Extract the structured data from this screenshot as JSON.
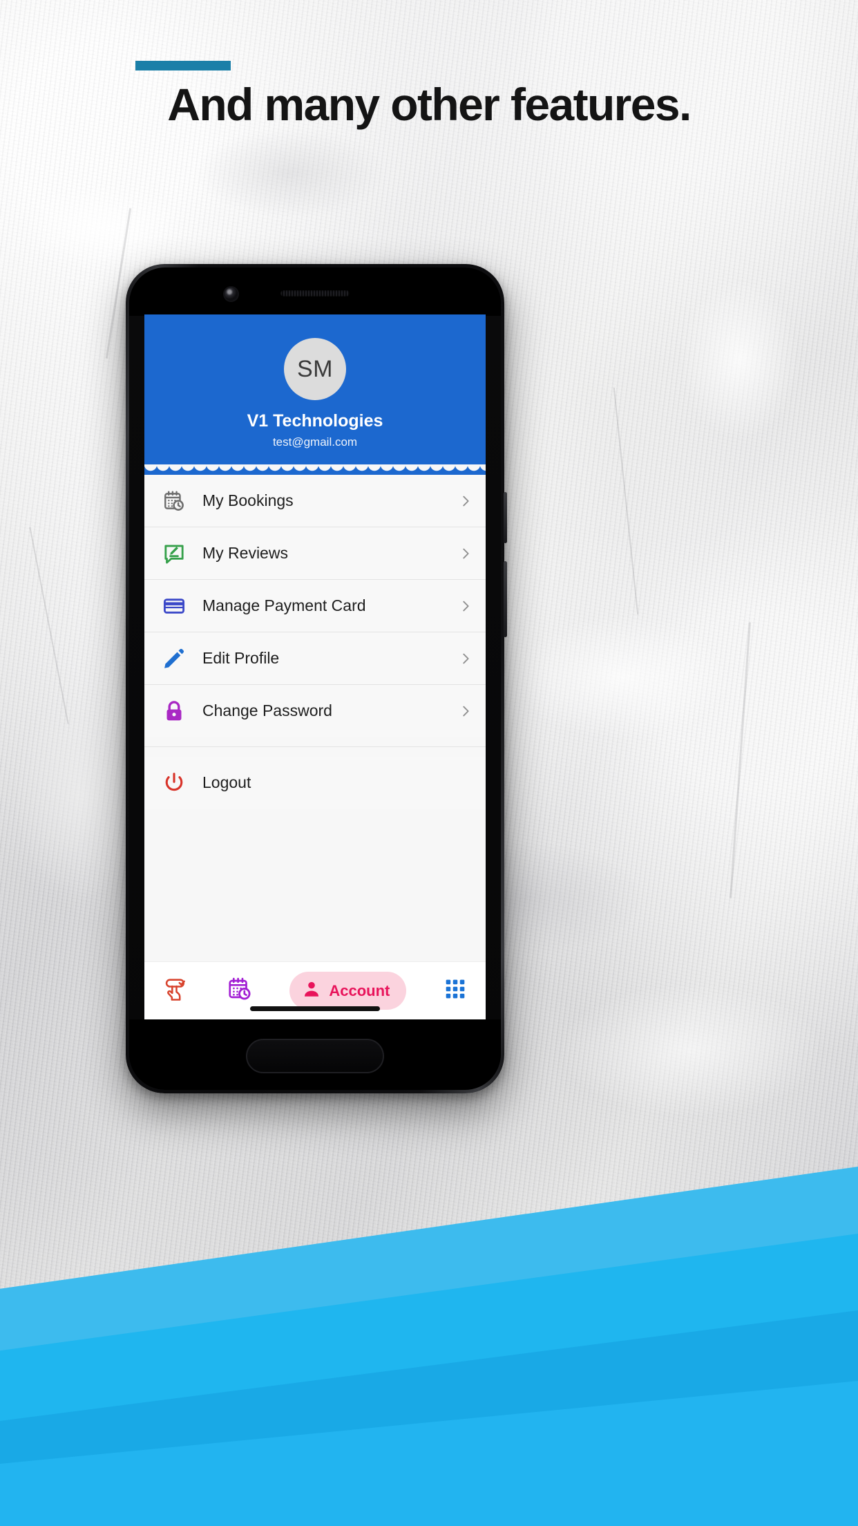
{
  "page": {
    "headline": "And many other features.",
    "accent_color": "#1b7fa8",
    "background_style": "concrete-wall-with-blue-waves"
  },
  "phone": {
    "device_chrome": [
      "front-camera",
      "earpiece-speaker",
      "home-button-outline"
    ]
  },
  "app": {
    "header": {
      "background_color": "#1c68cf",
      "avatar_initials": "SM",
      "profile_name": "V1 Technologies",
      "profile_email": "test@gmail.com"
    },
    "menu": {
      "items": [
        {
          "label": "My Bookings",
          "icon": "calendar-clock-icon",
          "icon_color": "#6d6d6d",
          "chevron": true
        },
        {
          "label": "My Reviews",
          "icon": "review-edit-icon",
          "icon_color": "#35a04a",
          "chevron": true
        },
        {
          "label": "Manage Payment Card",
          "icon": "credit-card-icon",
          "icon_color": "#3b48c8",
          "chevron": true
        },
        {
          "label": "Edit Profile",
          "icon": "pencil-icon",
          "icon_color": "#1f6fd0",
          "chevron": true
        },
        {
          "label": "Change Password",
          "icon": "lock-icon",
          "icon_color": "#a928c4",
          "chevron": true
        },
        {
          "label": "Logout",
          "icon": "power-icon",
          "icon_color": "#d8342a",
          "chevron": false
        }
      ]
    },
    "bottom_nav": {
      "items": [
        {
          "label": "",
          "icon": "tap-booking-icon",
          "icon_color": "#d8442e",
          "active": false
        },
        {
          "label": "",
          "icon": "calendar-clock-icon",
          "icon_color": "#a21fd4",
          "active": false
        },
        {
          "label": "Account",
          "icon": "person-icon",
          "icon_color": "#e8145b",
          "active": true,
          "pill_color": "#fbd3de"
        },
        {
          "label": "",
          "icon": "grid-apps-icon",
          "icon_color": "#1a73d6",
          "active": false
        }
      ]
    }
  }
}
